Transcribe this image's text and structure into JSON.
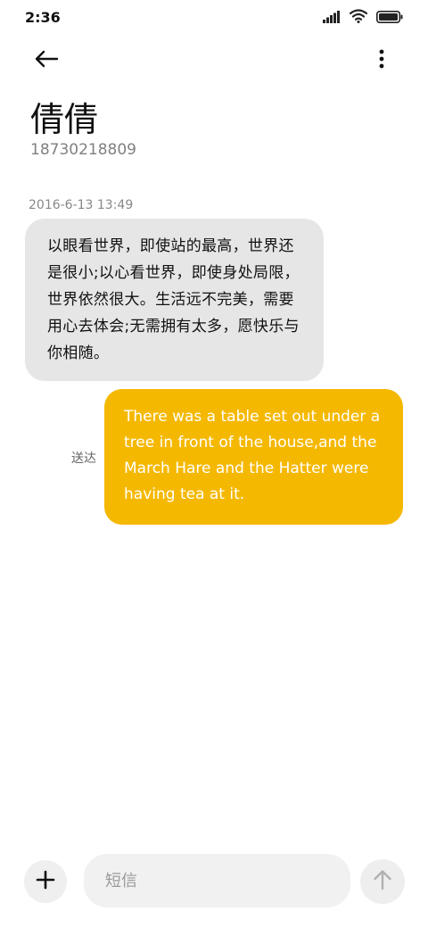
{
  "status_bar": {
    "time": "2:36",
    "icons": [
      "signal-icon",
      "wifi-icon",
      "battery-icon"
    ]
  },
  "header": {
    "back_icon": "back-arrow-icon",
    "more_icon": "more-vertical-icon"
  },
  "contact": {
    "name": "倩倩",
    "number": "18730218809"
  },
  "conversation": {
    "timestamp": "2016-6-13 13:49",
    "received_message": "以眼看世界，即使站的最高，世界还是很小;以心看世界，即使身处局限，世界依然很大。生活远不完美，需要用心去体会;无需拥有太多，愿快乐与你相随。",
    "sent_status": "送达",
    "sent_message": "There was a table set out under a tree in front of the house,and the March Hare and the Hatter were having tea at it."
  },
  "composer": {
    "placeholder": "短信",
    "add_icon": "plus-icon",
    "send_icon": "arrow-up-icon"
  },
  "colors": {
    "sent_bubble": "#f5b800",
    "received_bubble": "#e6e6e6"
  }
}
